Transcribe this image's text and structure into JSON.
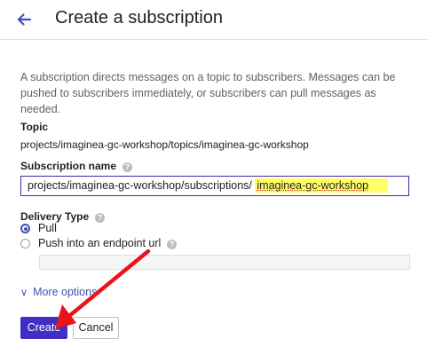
{
  "header": {
    "title": "Create a subscription"
  },
  "description": "A subscription directs messages on a topic to subscribers. Messages can be pushed to subscribers immediately, or subscribers can pull messages as needed.",
  "topic": {
    "label": "Topic",
    "value": "projects/imaginea-gc-workshop/topics/imaginea-gc-workshop"
  },
  "subscription": {
    "label": "Subscription name",
    "prefix": "projects/imaginea-gc-workshop/subscriptions/",
    "value": "imaginea-gc-workshop"
  },
  "delivery": {
    "label": "Delivery Type",
    "options": [
      {
        "label": "Pull",
        "selected": true
      },
      {
        "label": "Push into an endpoint url",
        "selected": false
      }
    ]
  },
  "more_options": "More options",
  "buttons": {
    "create": "Create",
    "cancel": "Cancel"
  },
  "colors": {
    "accent": "#3f51b5",
    "primary_button": "#3f2fc4",
    "annotation_arrow": "#e8141a",
    "highlight": "#ffff66"
  },
  "icons": {
    "back": "arrow-left-icon",
    "help": "help-icon",
    "expand": "chevron-down-icon"
  }
}
